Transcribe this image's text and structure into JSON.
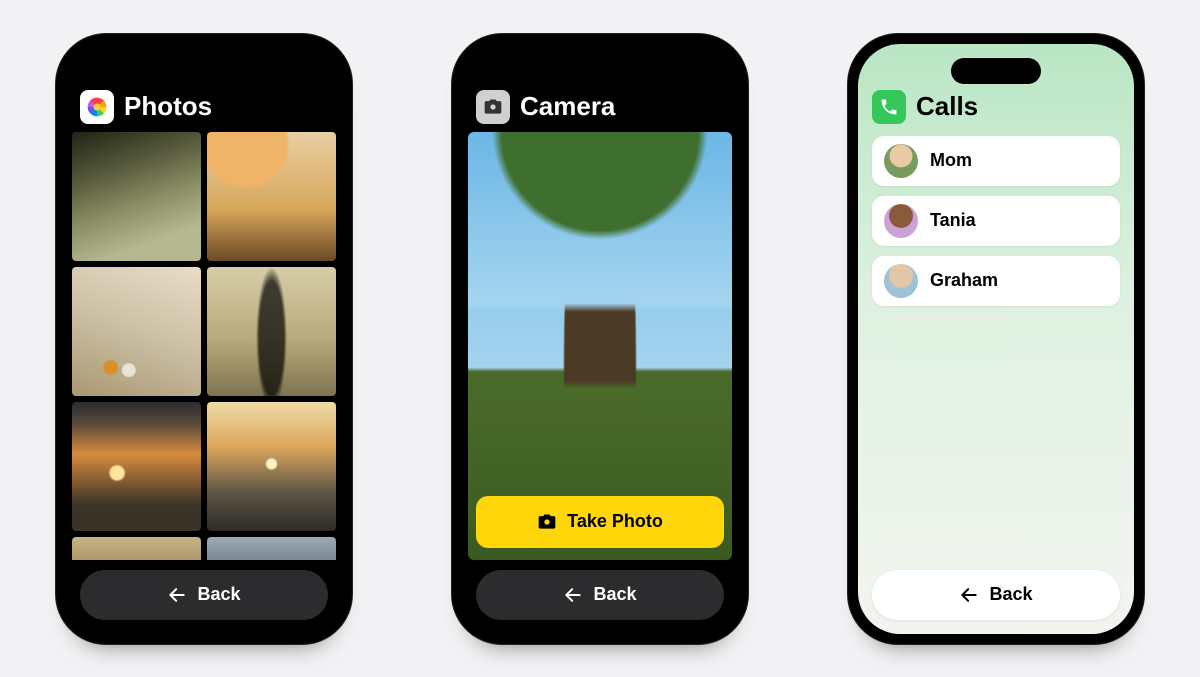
{
  "screens": {
    "photos": {
      "title": "Photos",
      "back_label": "Back",
      "thumbnails": [
        "stairs-woods",
        "orange-umbrella",
        "sand-shells",
        "shadow-person",
        "sunset-ocean",
        "sunset-beach",
        "sand-strip",
        "grey-strip"
      ]
    },
    "camera": {
      "title": "Camera",
      "take_photo_label": "Take Photo",
      "back_label": "Back"
    },
    "calls": {
      "title": "Calls",
      "back_label": "Back",
      "contacts": [
        {
          "name": "Mom"
        },
        {
          "name": "Tania"
        },
        {
          "name": "Graham"
        }
      ]
    }
  }
}
